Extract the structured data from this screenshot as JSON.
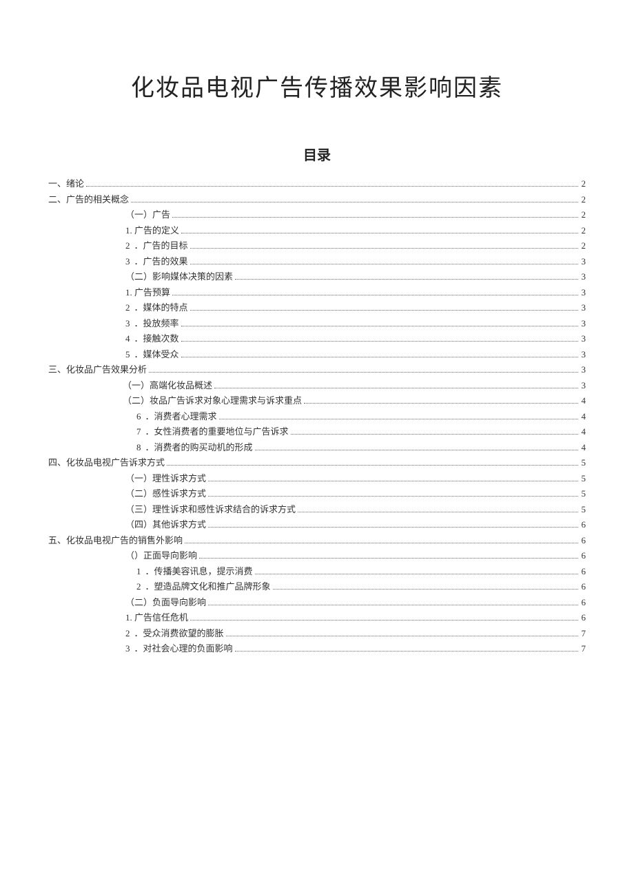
{
  "title": "化妆品电视广告传播效果影响因素",
  "toc_heading": "目录",
  "toc": [
    {
      "indent": "lvl-0",
      "num": "",
      "label": "一、绪论",
      "page": "2"
    },
    {
      "indent": "lvl-0",
      "num": "",
      "label": "二、广告的相关概念",
      "page": "2"
    },
    {
      "indent": "lvl-1",
      "num": "",
      "label": "（一）广告",
      "page": "2"
    },
    {
      "indent": "lvl-1",
      "num": "",
      "label": "1. 广告的定义",
      "page": "2"
    },
    {
      "indent": "lvl-1",
      "num": "2",
      "label": "．广告的目标",
      "page": "2"
    },
    {
      "indent": "lvl-1",
      "num": "3",
      "label": "．广告的效果",
      "page": "3"
    },
    {
      "indent": "lvl-1",
      "num": "",
      "label": "（二）影响媒体决策的因素",
      "page": "3"
    },
    {
      "indent": "lvl-1",
      "num": "",
      "label": "1. 广告预算",
      "page": "3"
    },
    {
      "indent": "lvl-1",
      "num": "2",
      "label": "．媒体的特点",
      "page": "3"
    },
    {
      "indent": "lvl-1",
      "num": "3",
      "label": "．投放频率",
      "page": "3"
    },
    {
      "indent": "lvl-1",
      "num": "4",
      "label": "．接触次数",
      "page": "3"
    },
    {
      "indent": "lvl-1",
      "num": "5",
      "label": "．媒体受众",
      "page": "3"
    },
    {
      "indent": "lvl-0",
      "num": "",
      "label": "三、化妆品广告效果分析",
      "page": "3"
    },
    {
      "indent": "lvl-1b",
      "num": "",
      "label": "（一）高端化妆品概述",
      "page": "3"
    },
    {
      "indent": "lvl-1b",
      "num": "",
      "label": "（二）妆品广告诉求对象心理需求与诉求重点",
      "page": "4"
    },
    {
      "indent": "lvl-2n",
      "num": "6",
      "label": "．消费者心理需求",
      "page": "4"
    },
    {
      "indent": "lvl-2n",
      "num": "7",
      "label": "．女性消费者的重要地位与广告诉求",
      "page": "4"
    },
    {
      "indent": "lvl-2n",
      "num": "8",
      "label": "．消费者的购买动机的形成",
      "page": "4"
    },
    {
      "indent": "lvl-0",
      "num": "",
      "label": "四、化妆品电视广告诉求方式",
      "page": "5"
    },
    {
      "indent": "lvl-1",
      "num": "",
      "label": "（一）理性诉求方式",
      "page": "5"
    },
    {
      "indent": "lvl-1",
      "num": "",
      "label": "（二）感性诉求方式",
      "page": "5"
    },
    {
      "indent": "lvl-1",
      "num": "",
      "label": "（三）理性诉求和感性诉求结合的诉求方式",
      "page": "5"
    },
    {
      "indent": "lvl-1",
      "num": "",
      "label": "（四）其他诉求方式",
      "page": "6"
    },
    {
      "indent": "lvl-0",
      "num": "",
      "label": "五、化妆品电视广告的销售外影响",
      "page": "6"
    },
    {
      "indent": "lvl-1",
      "num": "",
      "label": "（）正面导向影响",
      "page": "6"
    },
    {
      "indent": "lvl-2n",
      "num": "1",
      "label": "．传播美容讯息，提示消费",
      "page": "6"
    },
    {
      "indent": "lvl-2n",
      "num": "2",
      "label": "．塑造品牌文化和推广品牌形象",
      "page": "6"
    },
    {
      "indent": "lvl-1",
      "num": "",
      "label": "（二）负面导向影响",
      "page": "6"
    },
    {
      "indent": "lvl-1",
      "num": "",
      "label": "1. 广告信任危机",
      "page": "6"
    },
    {
      "indent": "lvl-1",
      "num": "2",
      "label": "．受众消费欲望的膨胀",
      "page": "7"
    },
    {
      "indent": "lvl-1",
      "num": "3",
      "label": "．对社会心理的负面影响",
      "page": "7"
    }
  ]
}
